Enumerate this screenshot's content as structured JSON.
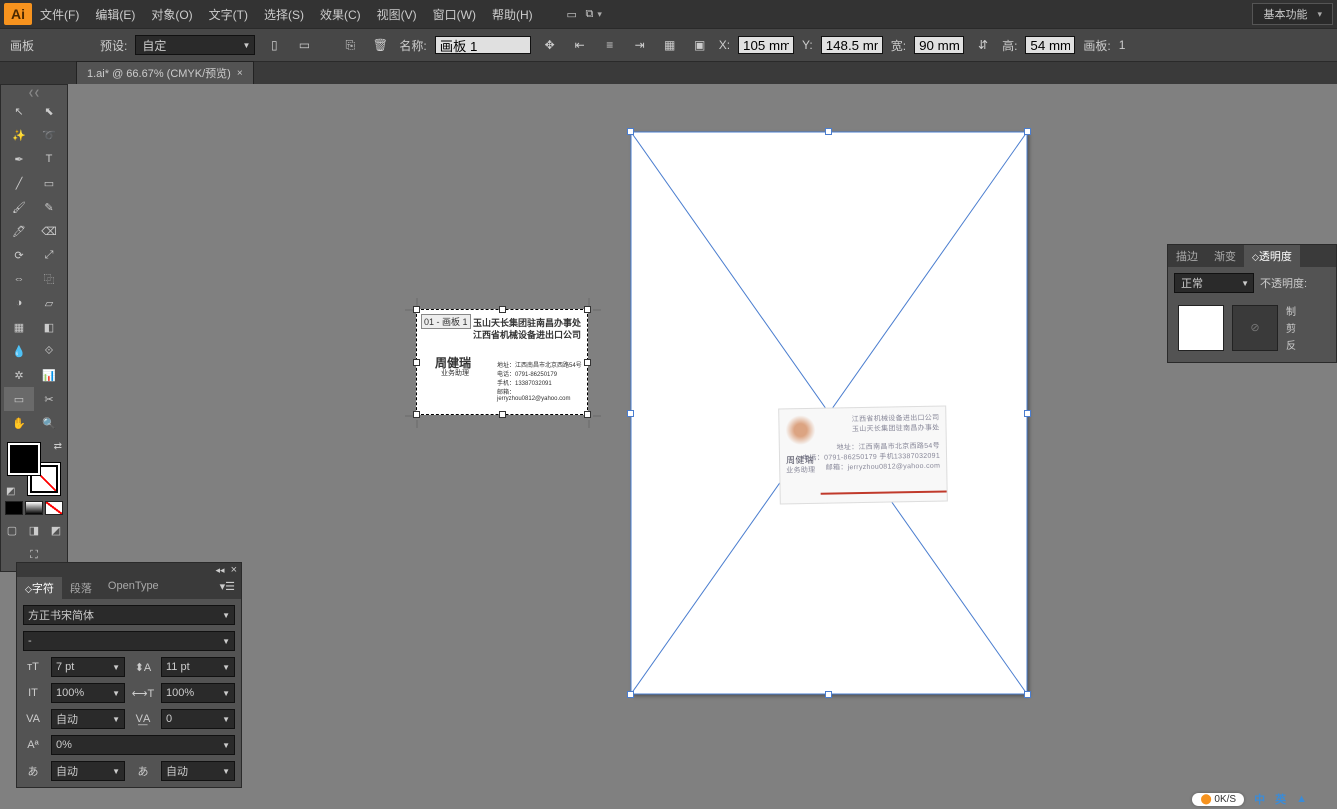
{
  "app": {
    "logo": "Ai"
  },
  "menu": {
    "file": "文件(F)",
    "edit": "编辑(E)",
    "object": "对象(O)",
    "type": "文字(T)",
    "select": "选择(S)",
    "effect": "效果(C)",
    "view": "视图(V)",
    "window": "窗口(W)",
    "help": "帮助(H)"
  },
  "workspace_label": "基本功能",
  "control": {
    "mode": "画板",
    "preset_label": "预设:",
    "preset_value": "自定",
    "name_label": "名称:",
    "name_value": "画板 1",
    "x_label": "X:",
    "x_value": "105 mm",
    "y_label": "Y:",
    "y_value": "148.5 mm",
    "w_label": "宽:",
    "w_value": "90 mm",
    "h_label": "高:",
    "h_value": "54 mm",
    "ab_label": "画板:",
    "ab_value": "1"
  },
  "doc_tab": {
    "title": "1.ai* @ 66.67% (CMYK/预览)"
  },
  "artboard_small": {
    "label": "01 - 画板 1",
    "line1": "玉山天长集团驻南昌办事处",
    "line2": "江西省机械设备进出口公司",
    "name": "周健瑞",
    "role": "业务助理",
    "addr": "地址：江西南昌市北京西路54号",
    "tel": "电话：0791-86250179",
    "mob": "手机：13387032091",
    "mail": "邮箱：jerryzhou0812@yahoo.com"
  },
  "transparency": {
    "tab_stroke": "描边",
    "tab_grad": "渐变",
    "tab_trans": "透明度",
    "blend_mode": "正常",
    "opacity_label": "不透明度:",
    "make_mask": "制",
    "clip": "剪",
    "invert": "反"
  },
  "character": {
    "tab_char": "字符",
    "tab_para": "段落",
    "tab_ot": "OpenType",
    "font": "方正书宋简体",
    "style": "-",
    "size": "7 pt",
    "leading": "11 pt",
    "hscale": "100%",
    "vscale": "100%",
    "kerning": "自动",
    "tracking": "0",
    "baseline": "0%",
    "something": "自动",
    "thing": "自动"
  },
  "taskbar": {
    "speed": "0K/S",
    "ime1": "中",
    "ime2": "英"
  }
}
